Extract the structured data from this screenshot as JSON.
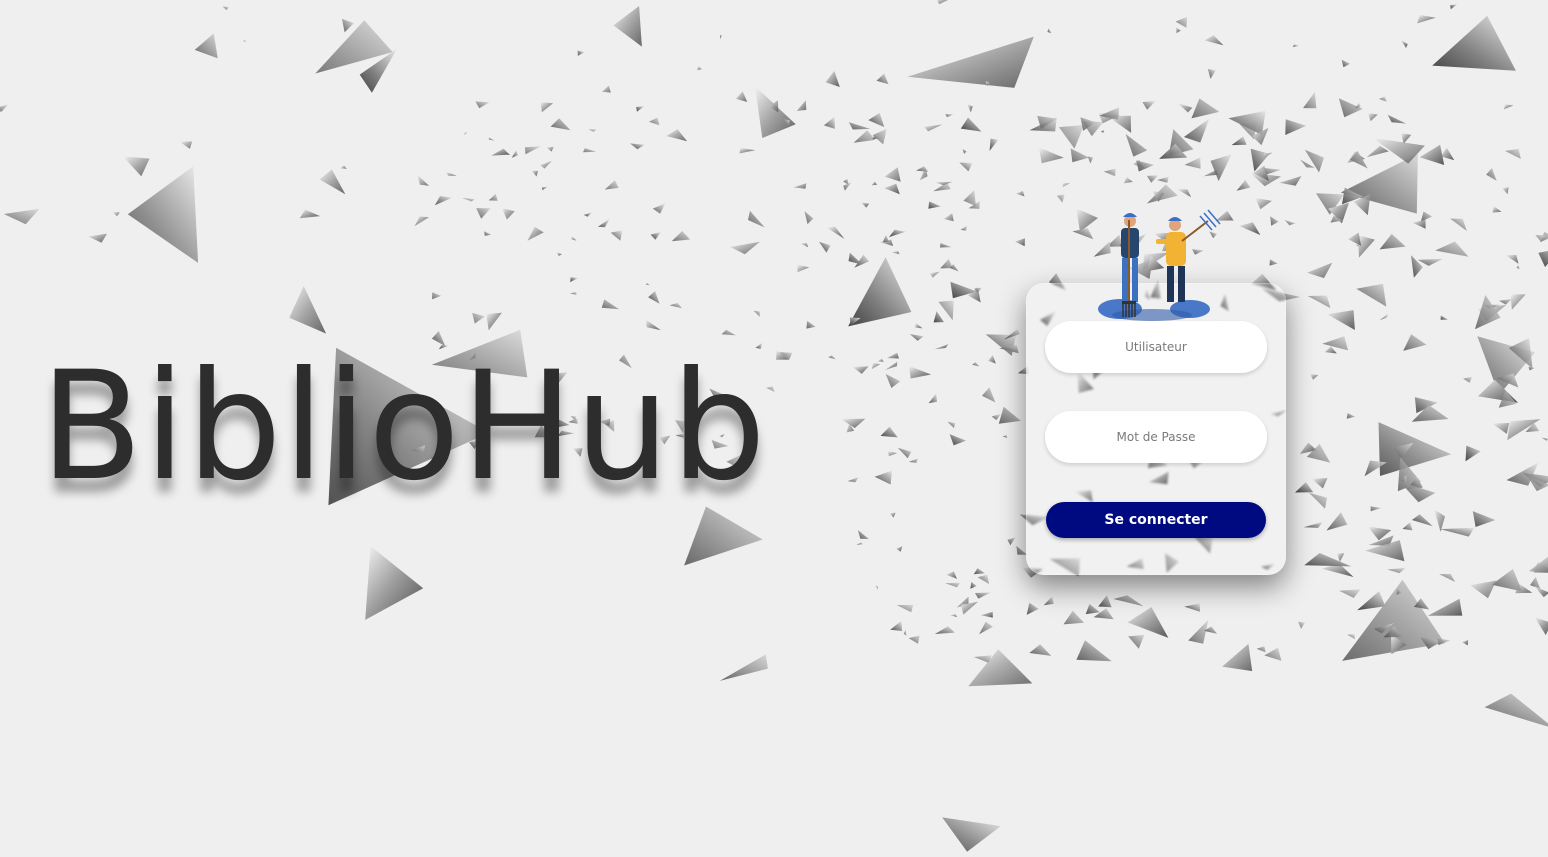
{
  "brand": {
    "title": "BiblioHub"
  },
  "login": {
    "username_placeholder": "Utilisateur",
    "password_placeholder": "Mot de Passe",
    "submit_label": "Se connecter"
  },
  "colors": {
    "background": "#efefef",
    "title_text": "#2d2d2d",
    "button_bg": "#000a80",
    "button_text": "#ffffff",
    "field_bg": "#ffffff"
  },
  "icons": {
    "hero_illustration": "two-farmers-with-pitchfork-icon"
  }
}
